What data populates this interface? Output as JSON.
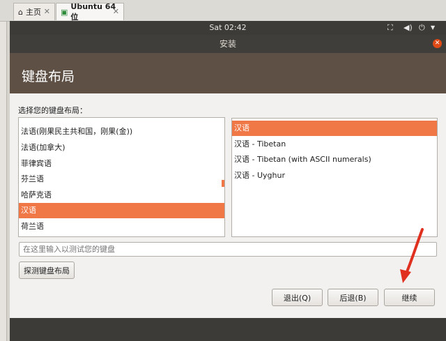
{
  "host_tabs": [
    {
      "label": "主页",
      "icon": "home-icon"
    },
    {
      "label": "Ubuntu 64 位",
      "icon": "vm-icon"
    }
  ],
  "panel": {
    "clock": "Sat 02:42",
    "icons": [
      "network-icon",
      "volume-icon",
      "power-icon",
      "chevron-down-icon"
    ]
  },
  "window": {
    "title": "安装"
  },
  "page": {
    "heading": "键盘布局",
    "choose_label": "选择您的键盘布局："
  },
  "layouts": [
    "法语(刚果民主共和国，刚果(金))",
    "法语(加拿大)",
    "菲律宾语",
    "芬兰语",
    "哈萨克语",
    "汉语",
    "荷兰语"
  ],
  "selected_layout": "汉语",
  "variants": [
    "汉语",
    "汉语 - Tibetan",
    "汉语 - Tibetan (with ASCII numerals)",
    "汉语 - Uyghur"
  ],
  "selected_variant": "汉语",
  "test_input": {
    "placeholder": "在这里输入以测试您的键盘",
    "value": ""
  },
  "buttons": {
    "detect": "探测键盘布局",
    "quit": "退出(Q)",
    "back": "后退(B)",
    "continue": "继续"
  },
  "colors": {
    "accent": "#f07746",
    "header": "#5e5045",
    "panel": "#3c3b37",
    "arrow": "#e03020"
  }
}
